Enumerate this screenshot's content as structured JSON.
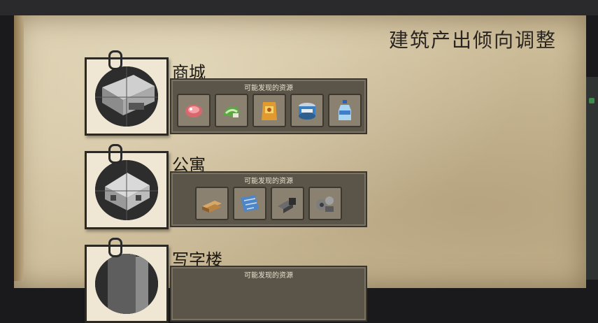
{
  "page_title": "建筑产出倾向调整",
  "buildings": [
    {
      "name": "商城",
      "resources_label": "可能发现的资源",
      "resources": [
        "meat-icon",
        "vegetables-icon",
        "chips-snack-icon",
        "canned-food-icon",
        "water-bottle-icon"
      ]
    },
    {
      "name": "公寓",
      "resources_label": "可能发现的资源",
      "resources": [
        "wood-planks-icon",
        "blueprint-fabric-icon",
        "metal-parts-icon",
        "mechanical-parts-icon"
      ]
    },
    {
      "name": "写字楼",
      "resources_label": "可能发现的资源",
      "resources": []
    }
  ]
}
